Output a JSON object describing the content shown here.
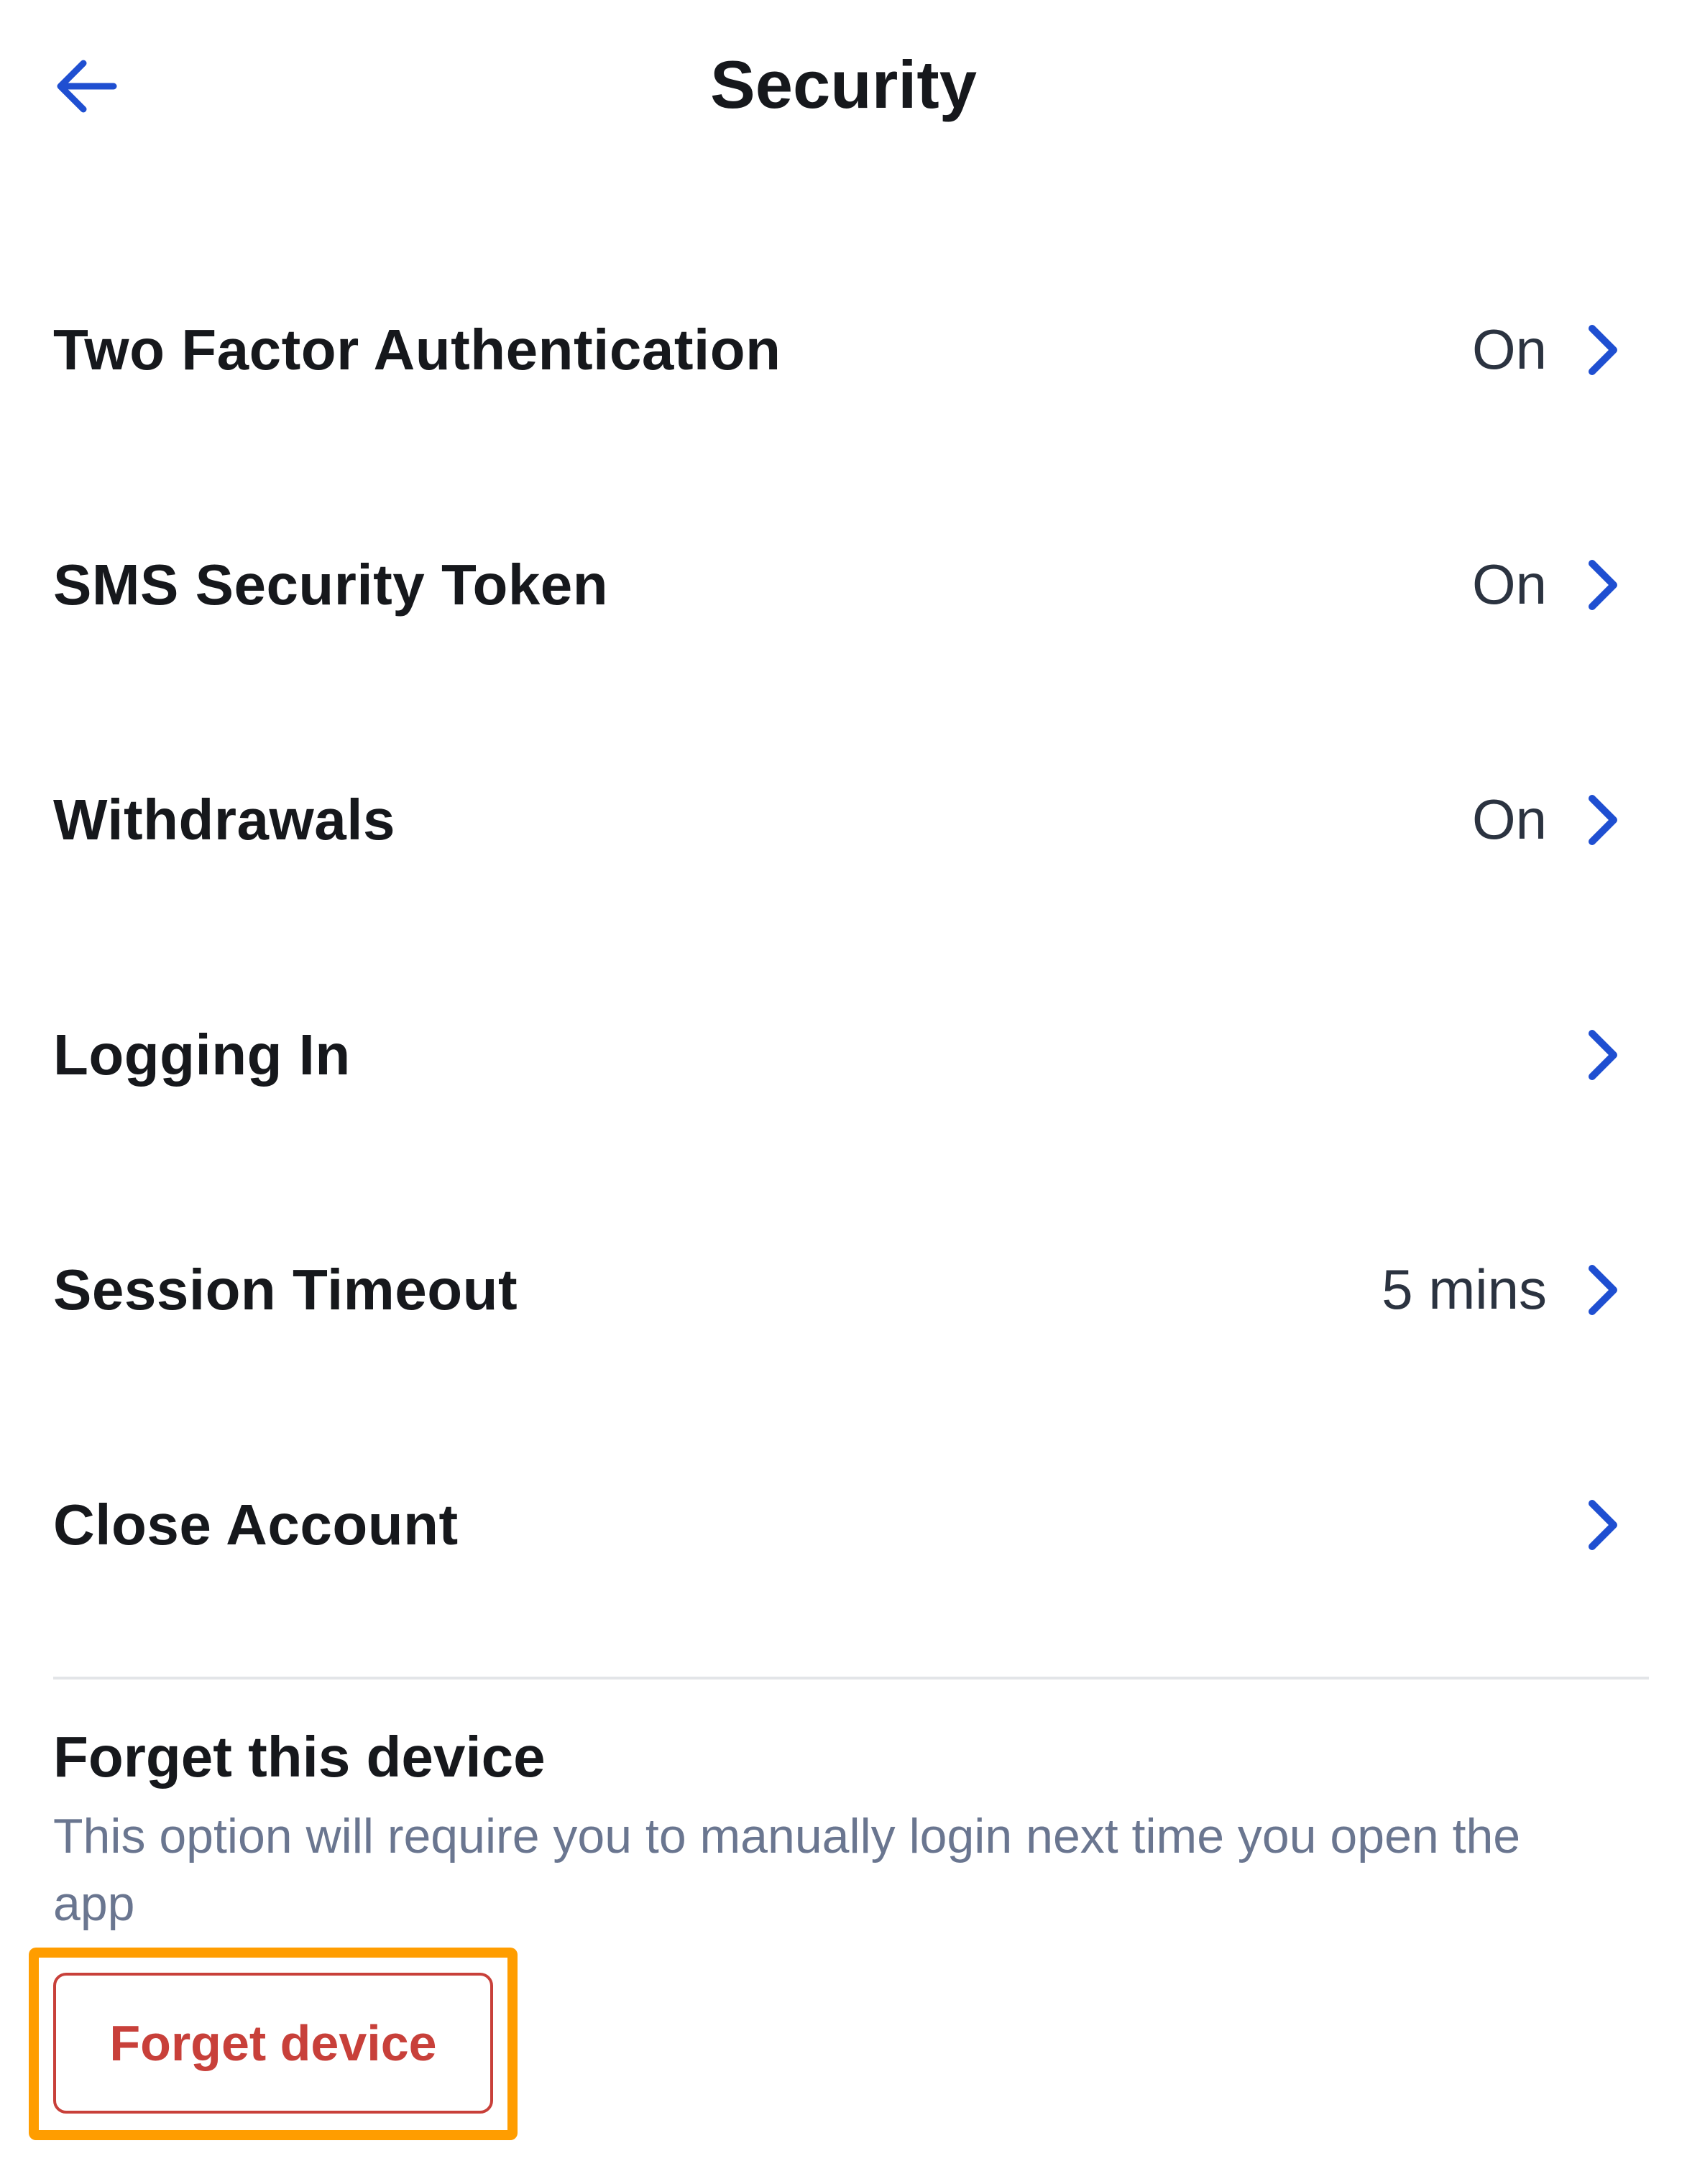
{
  "header": {
    "title": "Security",
    "back_icon": "arrow-left-icon"
  },
  "colors": {
    "accent": "#1f4fd1",
    "danger": "#c8403a",
    "highlight": "#ff9d00",
    "muted_text": "#6a7690"
  },
  "settings": [
    {
      "label": "Two Factor Authentication",
      "value": "On",
      "icon": "chevron-right-icon"
    },
    {
      "label": "SMS Security Token",
      "value": "On",
      "icon": "chevron-right-icon"
    },
    {
      "label": "Withdrawals",
      "value": "On",
      "icon": "chevron-right-icon"
    },
    {
      "label": "Logging In",
      "value": "",
      "icon": "chevron-right-icon"
    },
    {
      "label": "Session Timeout",
      "value": "5 mins",
      "icon": "chevron-right-icon"
    },
    {
      "label": "Close Account",
      "value": "",
      "icon": "chevron-right-icon"
    }
  ],
  "forget_device": {
    "title": "Forget this device",
    "description": "This option will require you to manually login next time you open the app",
    "button_label": "Forget device"
  }
}
